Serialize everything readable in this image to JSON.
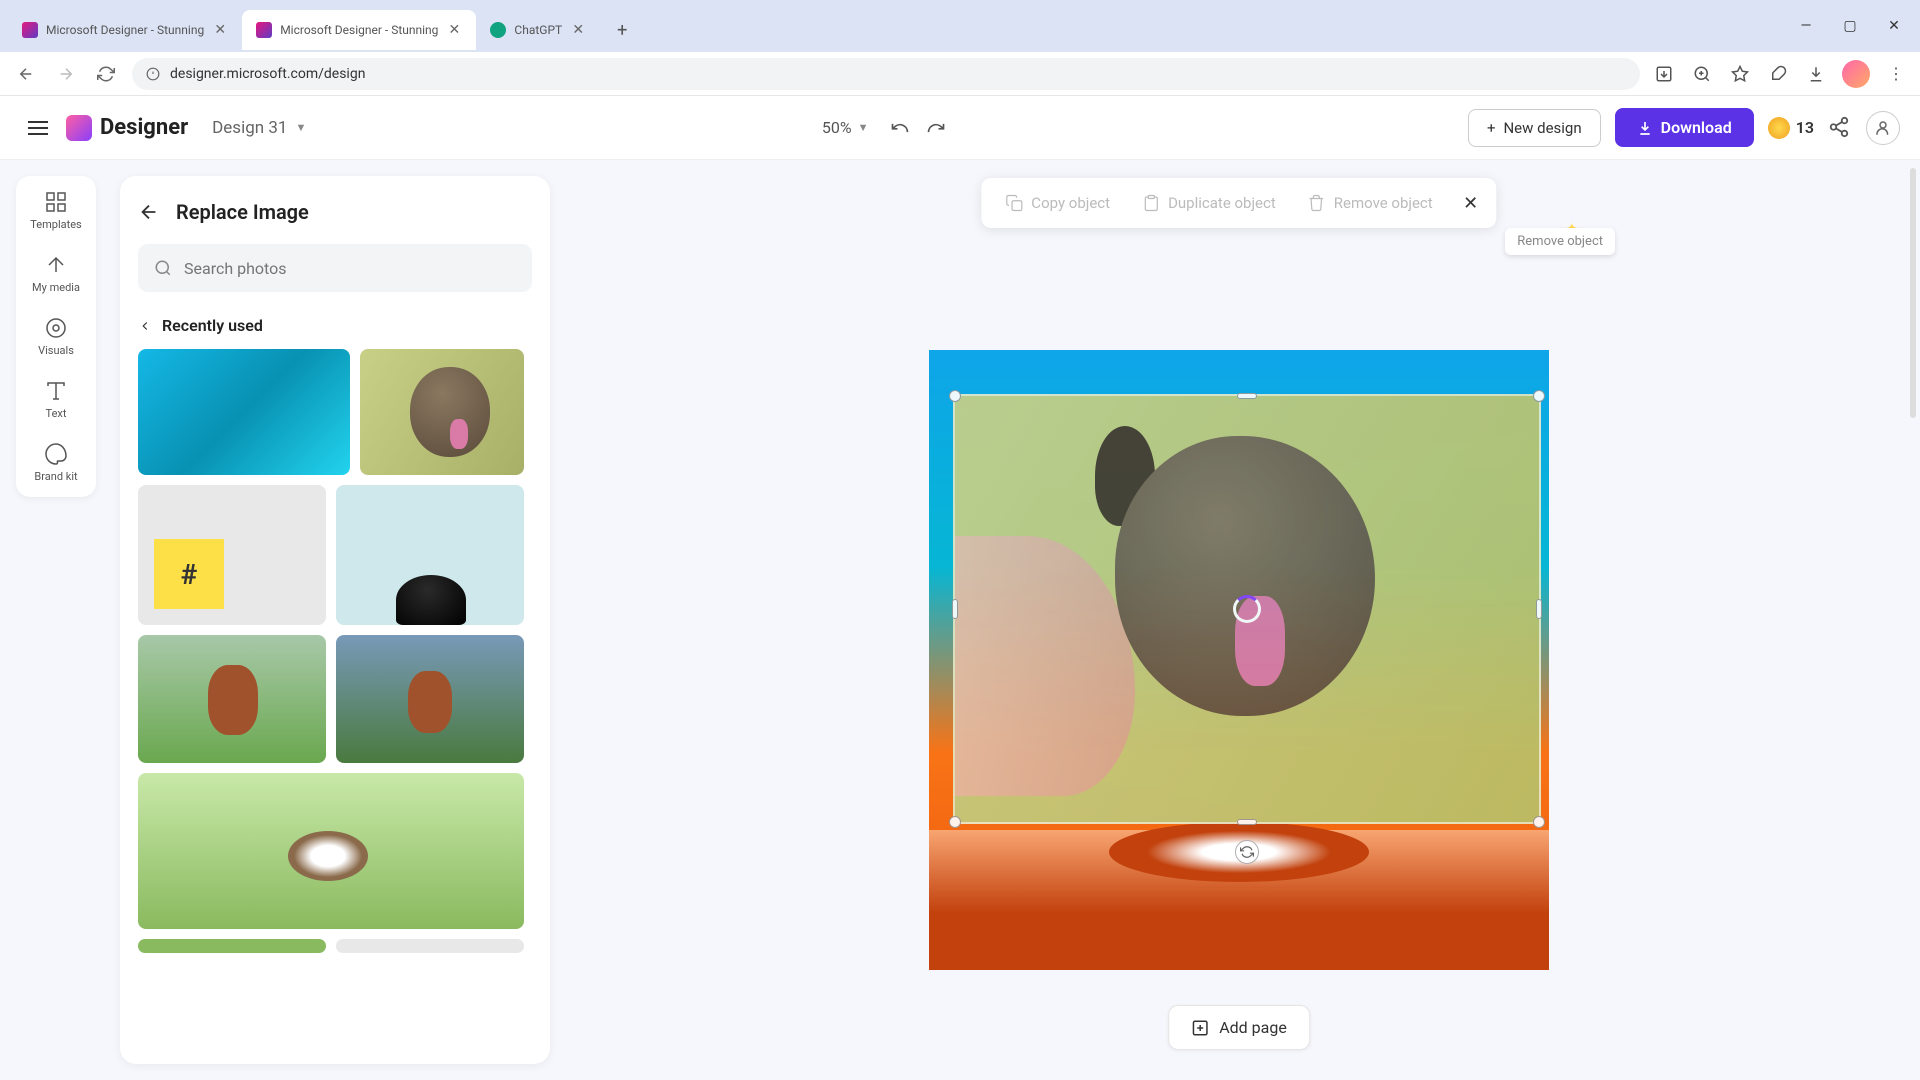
{
  "browser": {
    "tabs": [
      {
        "title": "Microsoft Designer - Stunning",
        "active": false
      },
      {
        "title": "Microsoft Designer - Stunning",
        "active": true
      },
      {
        "title": "ChatGPT",
        "active": false
      }
    ],
    "url": "designer.microsoft.com/design"
  },
  "app": {
    "logo": "Designer",
    "document_name": "Design 31",
    "zoom": "50%",
    "new_design_label": "New design",
    "download_label": "Download",
    "credits": "13"
  },
  "side_rail": {
    "items": [
      {
        "label": "Templates"
      },
      {
        "label": "My media"
      },
      {
        "label": "Visuals"
      },
      {
        "label": "Text"
      },
      {
        "label": "Brand kit"
      }
    ]
  },
  "panel": {
    "title": "Replace Image",
    "search_placeholder": "Search photos",
    "recent_label": "Recently used"
  },
  "context_bar": {
    "copy": "Copy object",
    "duplicate": "Duplicate object",
    "remove": "Remove object",
    "tooltip": "Remove object"
  },
  "add_page_label": "Add page"
}
